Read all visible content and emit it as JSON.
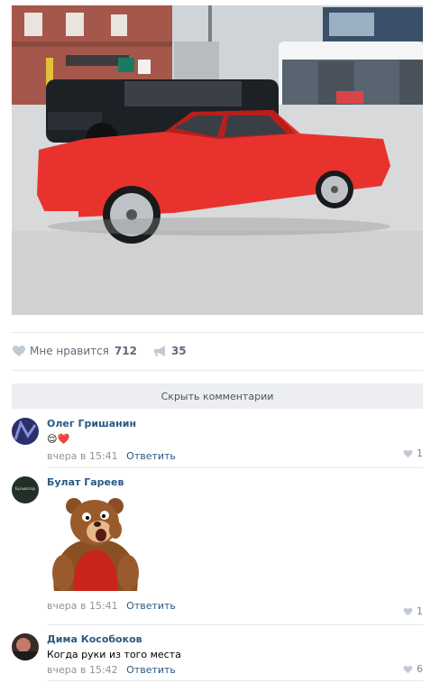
{
  "post": {
    "photo_alt": "",
    "like_label": "Мне нравится",
    "like_count": "712",
    "share_count": "35",
    "hide_comments_label": "Скрыть комментарии"
  },
  "comments": [
    {
      "author": "Олег Гришанин",
      "text": "😌❤️",
      "time": "вчера в 15:41",
      "reply": "Ответить",
      "likes": "1"
    },
    {
      "author": "Булат Гареев",
      "avatar_text": "Бульватор",
      "sticker": "bear-sticker",
      "time": "вчера в 15:41",
      "reply": "Ответить",
      "likes": "1"
    },
    {
      "author": "Дима Кособоков",
      "text": "Когда руки из того места",
      "time": "вчера в 15:42",
      "reply": "Ответить",
      "likes": "6"
    }
  ],
  "colors": {
    "link": "#2a5885",
    "meta": "#939393",
    "divider": "#e7e8ec",
    "button_bg": "#eceef1",
    "car": "#e8322e"
  }
}
